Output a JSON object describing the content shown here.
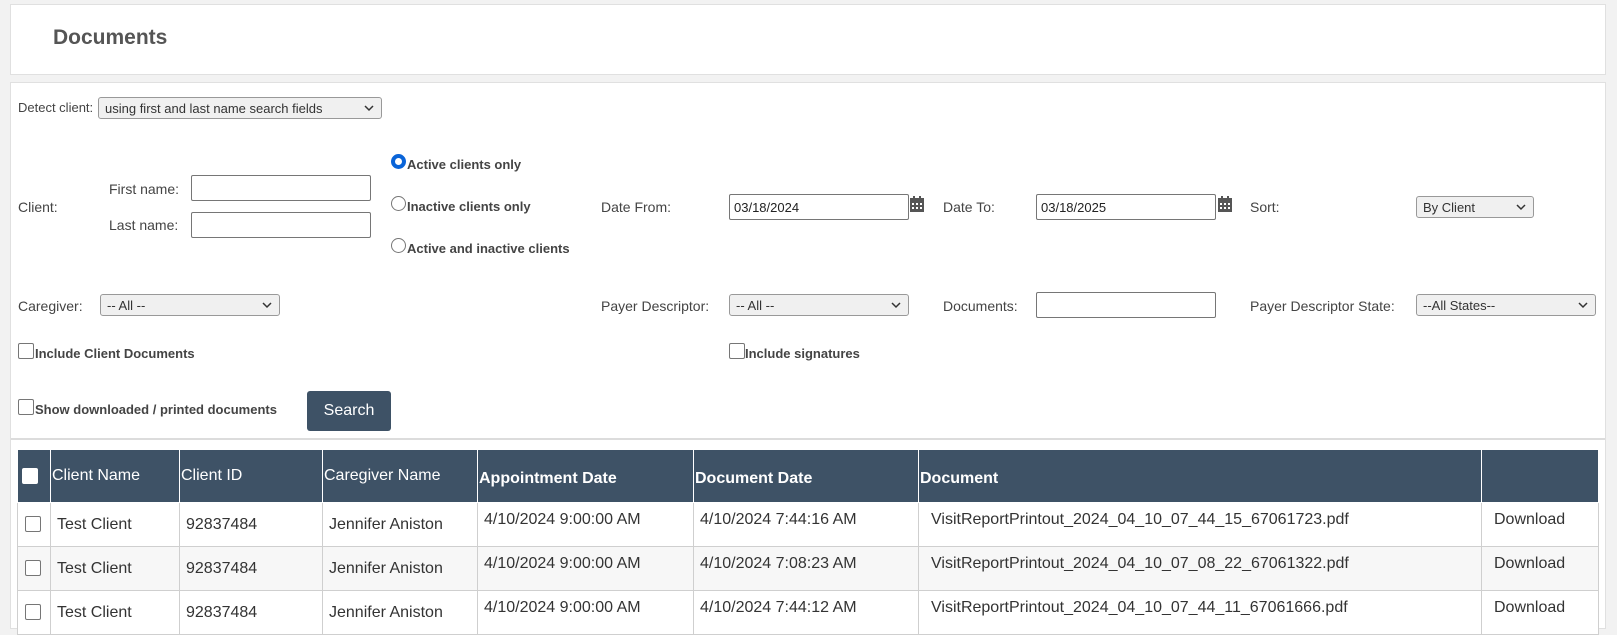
{
  "page": {
    "title": "Documents"
  },
  "filters": {
    "detect_client_label": "Detect client:",
    "detect_client_value": "using first and last name search fields",
    "client_label": "Client:",
    "first_name_label": "First name:",
    "first_name_value": "",
    "last_name_label": "Last name:",
    "last_name_value": "",
    "client_status_options": [
      "Active clients only",
      "Inactive clients only",
      "Active and inactive clients"
    ],
    "client_status_selected": "Active clients only",
    "date_from_label": "Date From:",
    "date_from_value": "03/18/2024",
    "date_to_label": "Date To:",
    "date_to_value": "03/18/2025",
    "sort_label": "Sort:",
    "sort_value": "By Client",
    "caregiver_label": "Caregiver:",
    "caregiver_value": "-- All --",
    "payer_descriptor_label": "Payer Descriptor:",
    "payer_descriptor_value": "-- All --",
    "documents_label": "Documents:",
    "documents_value": "",
    "payer_state_label": "Payer Descriptor State:",
    "payer_state_value": "--All States--",
    "include_client_documents_label": "Include Client Documents",
    "include_signatures_label": "Include signatures",
    "show_downloaded_label": "Show downloaded / printed documents",
    "search_button_label": "Search"
  },
  "table": {
    "headers": [
      "Client Name",
      "Client ID",
      "Caregiver Name",
      "Appointment Date",
      "Document Date",
      "Document",
      ""
    ],
    "rows": [
      {
        "client_name": "Test Client",
        "client_id": "92837484",
        "caregiver": "Jennifer Aniston",
        "appointment_date": "4/10/2024 9:00:00 AM",
        "document_date": "4/10/2024 7:44:16 AM",
        "document": "VisitReportPrintout_2024_04_10_07_44_15_67061723.pdf",
        "action": "Download"
      },
      {
        "client_name": "Test Client",
        "client_id": "92837484",
        "caregiver": "Jennifer Aniston",
        "appointment_date": "4/10/2024 9:00:00 AM",
        "document_date": "4/10/2024 7:08:23 AM",
        "document": "VisitReportPrintout_2024_04_10_07_08_22_67061322.pdf",
        "action": "Download"
      },
      {
        "client_name": "Test Client",
        "client_id": "92837484",
        "caregiver": "Jennifer Aniston",
        "appointment_date": "4/10/2024 9:00:00 AM",
        "document_date": "4/10/2024 7:44:12 AM",
        "document": "VisitReportPrintout_2024_04_10_07_44_11_67061666.pdf",
        "action": "Download"
      }
    ]
  },
  "colors": {
    "header_bg": "#3e5266",
    "radio_accent": "#0a64d8"
  },
  "icons": {
    "calendar": "calendar-icon",
    "chevron": "chevron-down-icon"
  }
}
